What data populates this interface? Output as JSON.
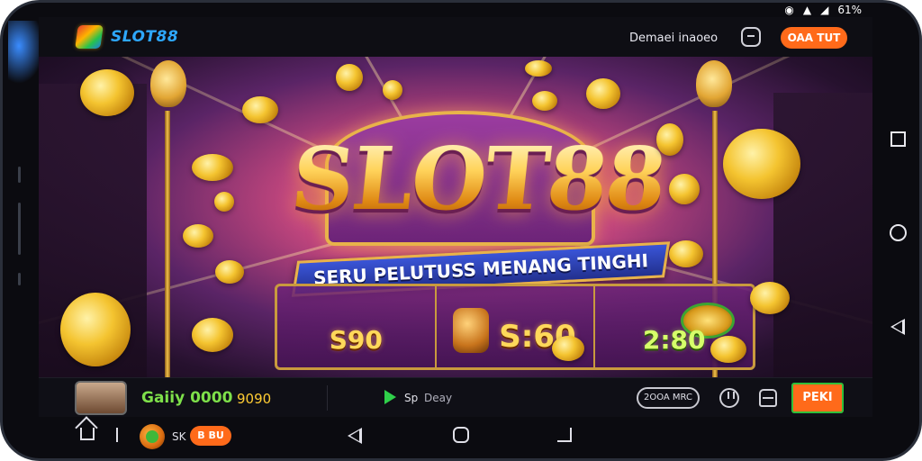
{
  "status_bar": {
    "time_glyph": "☉",
    "signal_text": "⏁",
    "battery_text": "61%"
  },
  "app_bar": {
    "logo_text": "SLOT88",
    "link_text": "Demaei inaoeo",
    "cta_label": "OAA TUT"
  },
  "hero": {
    "title": "SLOT88",
    "subtitle": "SERU PELUTUSS MENANG TINGHI",
    "panels": [
      {
        "value": "S90"
      },
      {
        "value": "S:60"
      },
      {
        "value": "2:80"
      }
    ]
  },
  "bottom_bar": {
    "username": "Gaiiy 0000",
    "balance": "9090",
    "demo_prefix": "Sp",
    "demo_label": "Deay",
    "pill_label": "2OOA MRC",
    "bet_label": "PEKI"
  },
  "lower_nav": {
    "sk_text": "SK",
    "pill_label": "B BU"
  },
  "colors": {
    "accent_orange": "#ff6a1a",
    "logo_blue": "#2ea8ff",
    "username_green": "#7ee04a",
    "gold": "#ffd35a"
  },
  "icons": [
    "profile-icon",
    "lock-icon",
    "play-icon",
    "home-icon",
    "back-icon",
    "square-icon",
    "circle-icon"
  ]
}
